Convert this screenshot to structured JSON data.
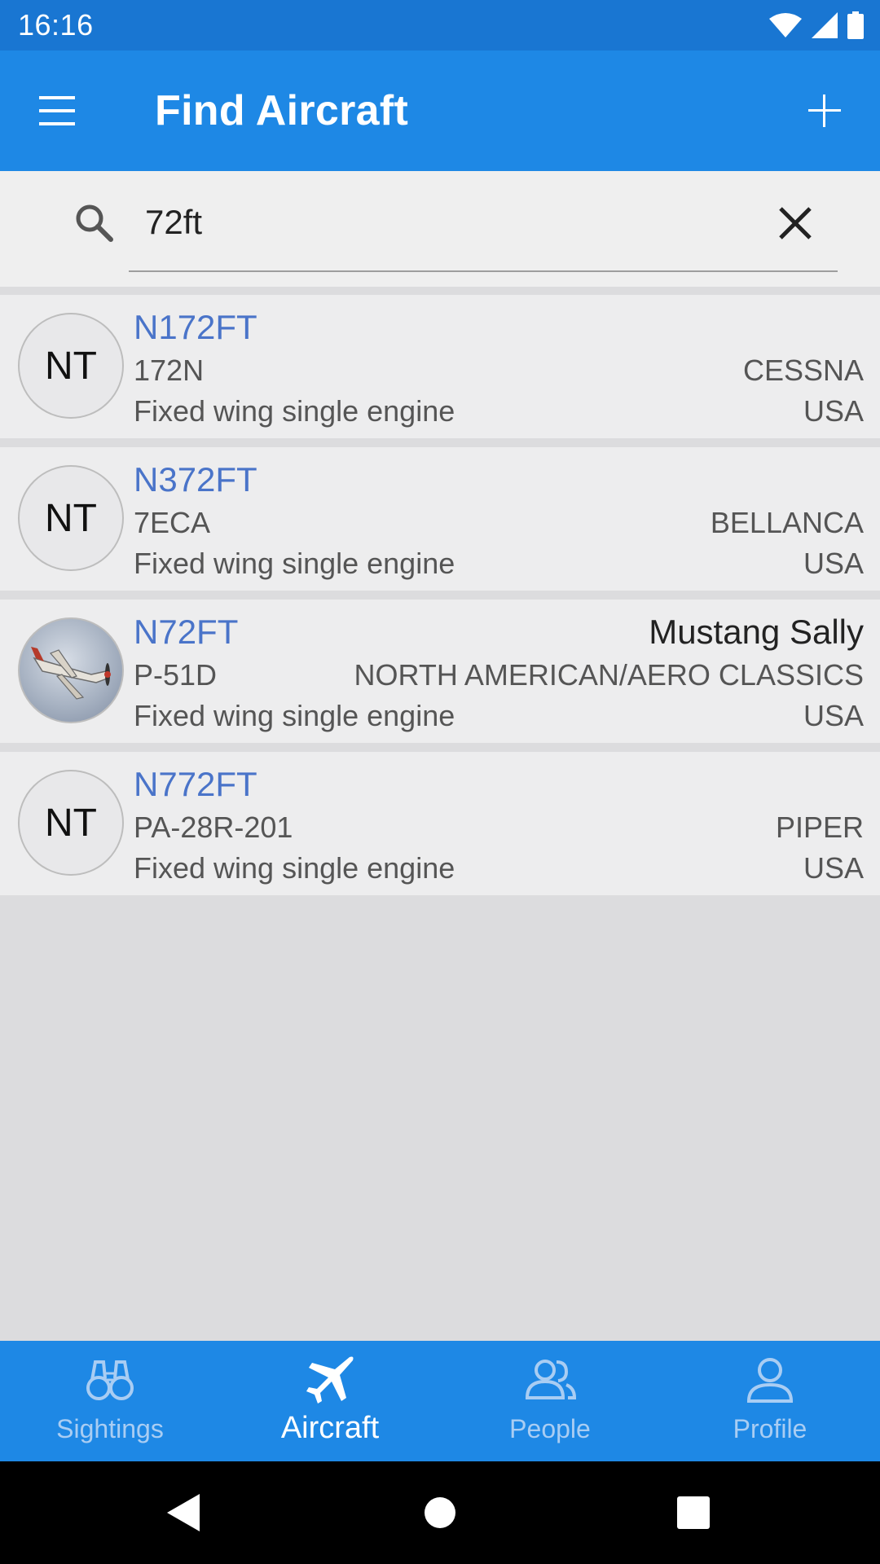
{
  "status_bar": {
    "time": "16:16"
  },
  "app_bar": {
    "title": "Find Aircraft"
  },
  "search": {
    "value": "72ft",
    "placeholder": ""
  },
  "results": [
    {
      "registration": "N172FT",
      "nickname": "",
      "model": "172N",
      "manufacturer": "CESSNA",
      "category": "Fixed wing single engine",
      "country": "USA",
      "avatar_text": "NT",
      "has_photo": false
    },
    {
      "registration": "N372FT",
      "nickname": "",
      "model": "7ECA",
      "manufacturer": "BELLANCA",
      "category": "Fixed wing single engine",
      "country": "USA",
      "avatar_text": "NT",
      "has_photo": false
    },
    {
      "registration": "N72FT",
      "nickname": "Mustang Sally",
      "model": "P-51D",
      "manufacturer": "NORTH AMERICAN/AERO CLASSICS",
      "category": "Fixed wing single engine",
      "country": "USA",
      "avatar_text": "",
      "has_photo": true
    },
    {
      "registration": "N772FT",
      "nickname": "",
      "model": "PA-28R-201",
      "manufacturer": "PIPER",
      "category": "Fixed wing single engine",
      "country": "USA",
      "avatar_text": "NT",
      "has_photo": false
    }
  ],
  "bottom_nav": {
    "items": [
      {
        "label": "Sightings",
        "icon": "binoculars-icon",
        "active": false
      },
      {
        "label": "Aircraft",
        "icon": "airplane-icon",
        "active": true
      },
      {
        "label": "People",
        "icon": "people-icon",
        "active": false
      },
      {
        "label": "Profile",
        "icon": "person-icon",
        "active": false
      }
    ]
  },
  "colors": {
    "status_bar": "#1976d2",
    "app_bar": "#1e88e5",
    "registration_text": "#4a74c9",
    "nav_inactive": "#a9cdf3"
  }
}
